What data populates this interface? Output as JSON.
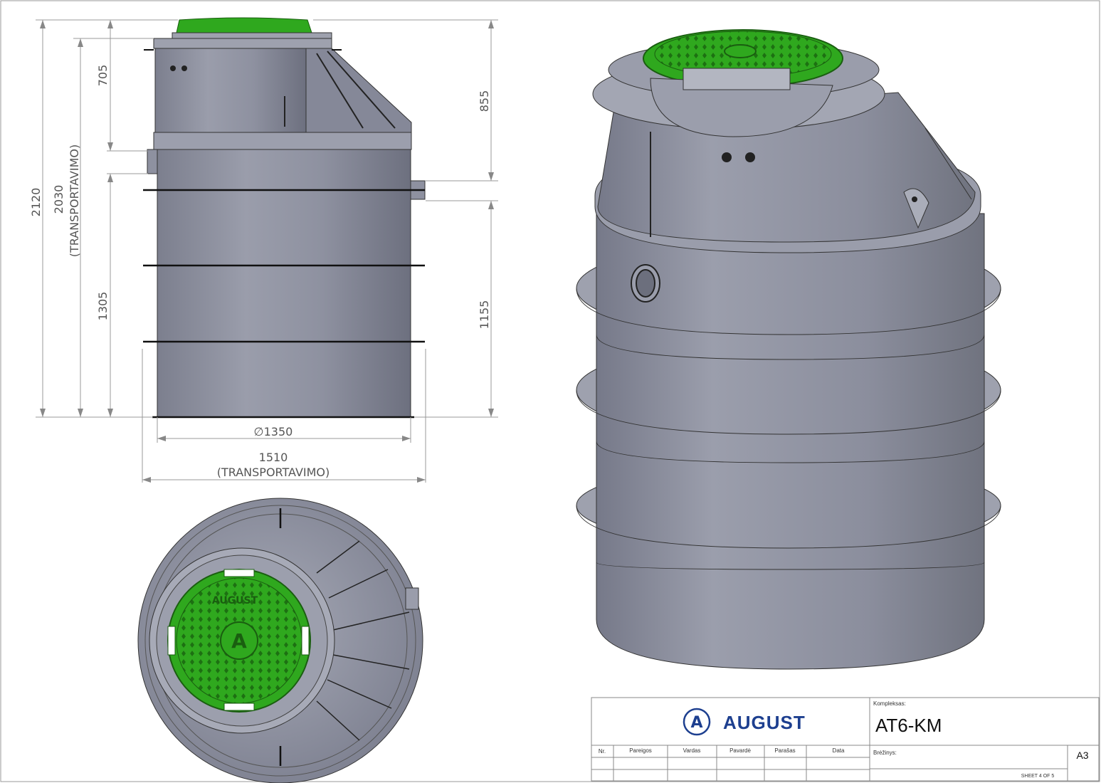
{
  "dimensions": {
    "height_total": "2120",
    "height_transport": "2030",
    "height_transport_note": "(TRANSPORTAVIMO)",
    "upper_height": "705",
    "lower_height": "1305",
    "inlet_height": "855",
    "outlet_height": "1155",
    "diameter": "∅1350",
    "width_transport": "1510",
    "width_transport_note": "(TRANSPORTAVIMO)"
  },
  "lid": {
    "brand_text": "AUGUST",
    "letter": "A"
  },
  "title_block": {
    "logo_letter": "A",
    "company": "AUGUST",
    "kompleksas_label": "Kompleksas:",
    "product": "AT6-KM",
    "columns": [
      "Nr.",
      "Pareigos",
      "Vardas",
      "Pavardė",
      "Parašas",
      "Data"
    ],
    "brezinys_label": "Brėžinys:",
    "sheet_format": "A3",
    "sheet_number": "SHEET 4 OF 5"
  },
  "colors": {
    "tank": "#8a8d9c",
    "tank_dark": "#6e7180",
    "lid_green": "#2fa81e",
    "brand_blue": "#1d3f8f"
  }
}
